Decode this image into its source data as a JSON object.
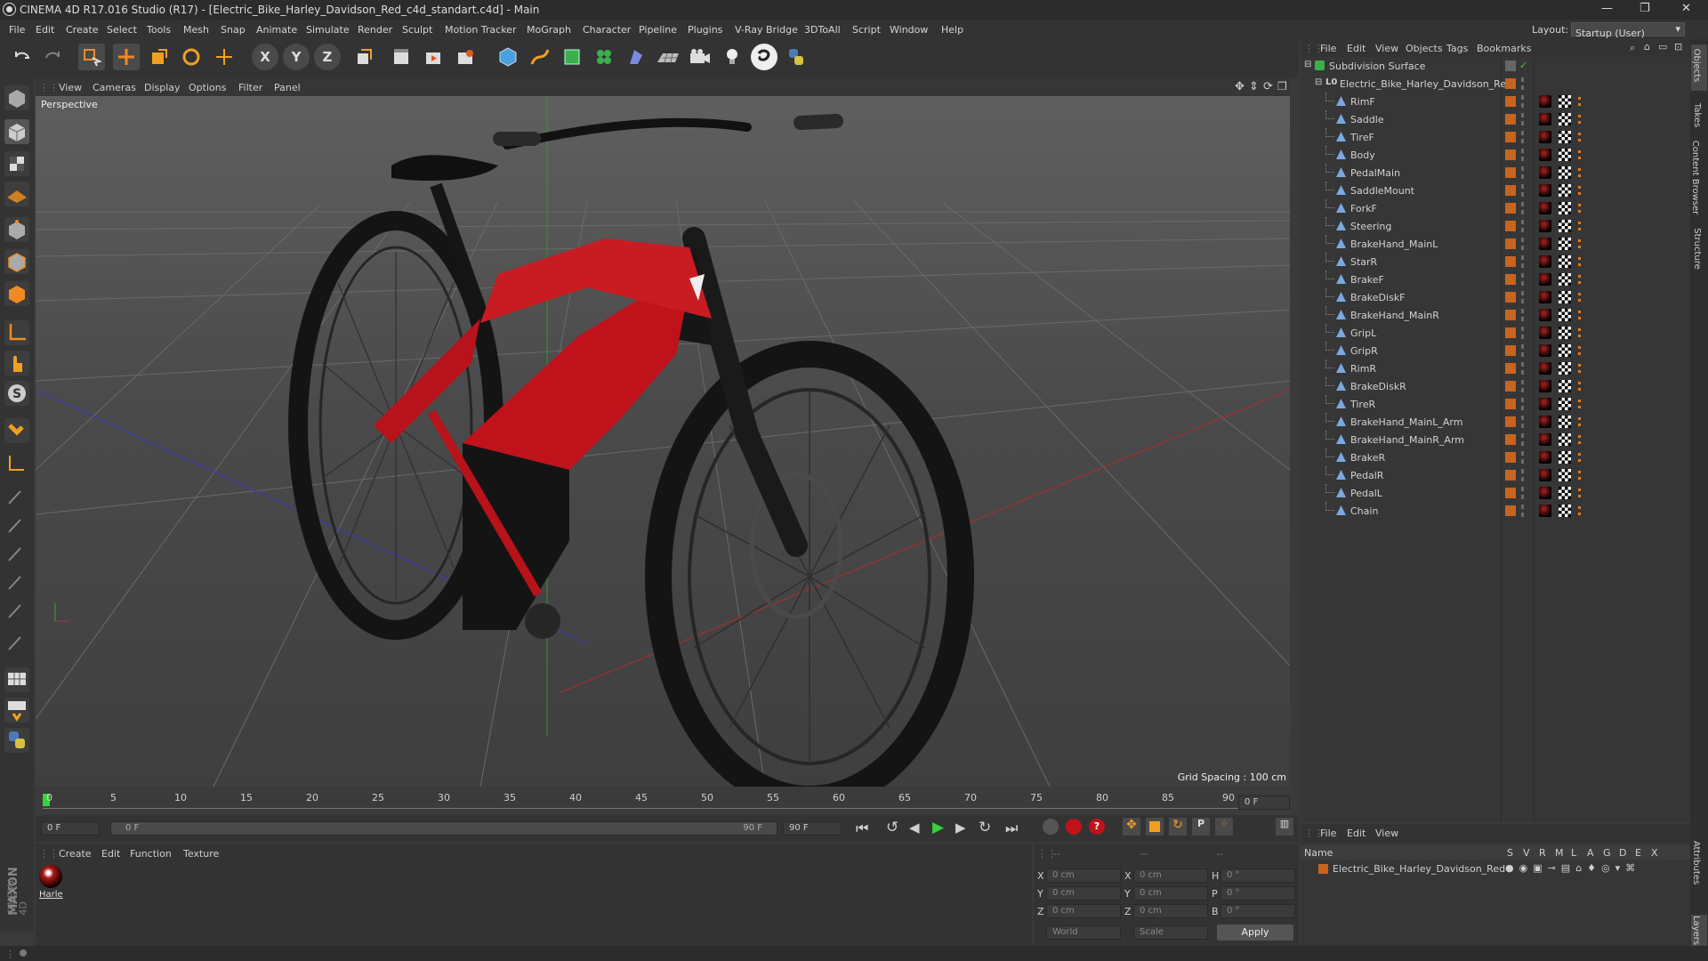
{
  "window": {
    "title": "CINEMA 4D R17.016 Studio (R17) - [Electric_Bike_Harley_Davidson_Red_c4d_standart.c4d] - Main"
  },
  "menu": [
    "File",
    "Edit",
    "Create",
    "Select",
    "Tools",
    "Mesh",
    "Snap",
    "Animate",
    "Simulate",
    "Render",
    "Sculpt",
    "Motion Tracker",
    "MoGraph",
    "Character",
    "Pipeline",
    "Plugins",
    "V-Ray Bridge",
    "3DToAll",
    "Script",
    "Window",
    "Help"
  ],
  "layout": {
    "label": "Layout:",
    "value": "Startup (User)"
  },
  "viewport": {
    "menu": [
      "View",
      "Cameras",
      "Display",
      "Options",
      "Filter",
      "Panel"
    ],
    "label": "Perspective",
    "grid_spacing": "Grid Spacing : 100 cm"
  },
  "timeline": {
    "ticks": [
      "0",
      "5",
      "10",
      "15",
      "20",
      "25",
      "30",
      "35",
      "40",
      "45",
      "50",
      "55",
      "60",
      "65",
      "70",
      "75",
      "80",
      "85",
      "90"
    ],
    "end_frame_field": "0 F",
    "start_field": "0 F",
    "slider_left": "0 F",
    "slider_right": "90 F",
    "end_field": "90 F"
  },
  "material_manager": {
    "menu": [
      "Create",
      "Edit",
      "Function",
      "Texture"
    ],
    "materials": [
      {
        "name": "Harle"
      }
    ]
  },
  "coordinates": {
    "pos": {
      "x": "0 cm",
      "y": "0 cm",
      "z": "0 cm"
    },
    "size": {
      "x": "0 cm",
      "y": "0 cm",
      "z": "0 cm"
    },
    "rot": {
      "h": "0 °",
      "p": "0 °",
      "b": "0 °"
    },
    "mode1": "World",
    "mode2": "Scale",
    "apply": "Apply",
    "col_labels": [
      "--",
      "--",
      "--"
    ]
  },
  "object_manager": {
    "menu": [
      "File",
      "Edit",
      "View",
      "Objects",
      "Tags",
      "Bookmarks"
    ],
    "root": "Subdivision Surface",
    "group": "Electric_Bike_Harley_Davidson_Red",
    "children": [
      "RimF",
      "Saddle",
      "TireF",
      "Body",
      "PedalMain",
      "SaddleMount",
      "ForkF",
      "Steering",
      "BrakeHand_MainL",
      "StarR",
      "BrakeF",
      "BrakeDiskF",
      "BrakeHand_MainR",
      "GripL",
      "GripR",
      "RimR",
      "BrakeDiskR",
      "TireR",
      "BrakeHand_MainL_Arm",
      "BrakeHand_MainR_Arm",
      "BrakeR",
      "PedalR",
      "PedalL",
      "Chain"
    ]
  },
  "layer_manager": {
    "menu": [
      "File",
      "Edit",
      "View"
    ],
    "header_name": "Name",
    "header_cols": [
      "S",
      "V",
      "R",
      "M",
      "L",
      "A",
      "G",
      "D",
      "E",
      "X"
    ],
    "layer": "Electric_Bike_Harley_Davidson_Red"
  },
  "side_tabs": [
    "Objects",
    "Takes",
    "Content Browser",
    "Structure",
    "Attributes",
    "Layers"
  ],
  "branding": {
    "maxon": "MAXON",
    "c4d": "CINEMA 4D"
  },
  "colors": {
    "accent_orange": "#e07c1a",
    "bike_red": "#c0121b",
    "play_green": "#3ad23a"
  }
}
